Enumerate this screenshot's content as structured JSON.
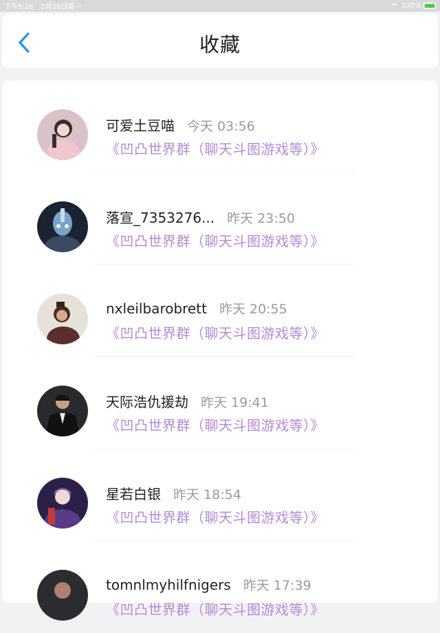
{
  "status_bar": {
    "time": "下午5:28",
    "date": "2月28日周一",
    "battery": "100%"
  },
  "header": {
    "title": "收藏",
    "back_icon": "chevron-left-icon"
  },
  "favorites": [
    {
      "name": "可爱土豆喵",
      "time": "今天 03:56",
      "group": "《凹凸世界群（聊天斗图游戏等）》"
    },
    {
      "name": "落宣_7353276...",
      "time": "昨天 23:50",
      "group": "《凹凸世界群（聊天斗图游戏等）》"
    },
    {
      "name": "nxleilbarobrett",
      "time": "昨天 20:55",
      "group": "《凹凸世界群（聊天斗图游戏等）》"
    },
    {
      "name": "天际浩仇援劫",
      "time": "昨天 19:41",
      "group": "《凹凸世界群（聊天斗图游戏等）》"
    },
    {
      "name": "星若白银",
      "time": "昨天 18:54",
      "group": "《凹凸世界群（聊天斗图游戏等）》"
    },
    {
      "name": "tomnlmyhilfnigers",
      "time": "昨天 17:39",
      "group": "《凹凸世界群（聊天斗图游戏等）》"
    }
  ],
  "colors": {
    "accent": "#2b8ff0",
    "group_link": "#b48ad6",
    "time": "#9a9a9a"
  }
}
